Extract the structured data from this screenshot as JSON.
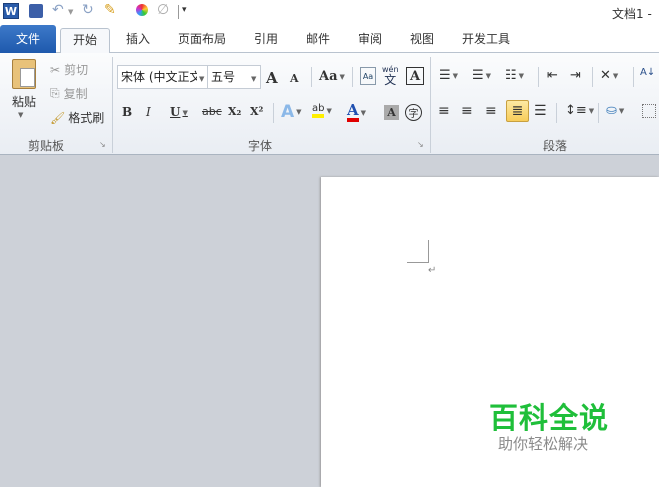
{
  "window": {
    "title": "文档1 -"
  },
  "qat": {
    "app_icon": "W"
  },
  "tabs": [
    {
      "label": "文件"
    },
    {
      "label": "开始"
    },
    {
      "label": "插入"
    },
    {
      "label": "页面布局"
    },
    {
      "label": "引用"
    },
    {
      "label": "邮件"
    },
    {
      "label": "审阅"
    },
    {
      "label": "视图"
    },
    {
      "label": "开发工具"
    }
  ],
  "clipboard": {
    "paste": "粘贴",
    "cut": "剪切",
    "copy": "复制",
    "format_painter": "格式刷",
    "group": "剪贴板"
  },
  "font": {
    "name": "宋体 (中文正文",
    "size": "五号",
    "group": "字体",
    "change_case": "Aa",
    "bold": "B",
    "italic": "I",
    "underline": "U",
    "strike": "abc",
    "sub": "X₂",
    "sup": "X²",
    "pinyin": "wén",
    "pinyin_char": "文",
    "border_char": "A",
    "effects": "A",
    "font_color": "A",
    "shading": "A",
    "enclose": "字",
    "grow": "A",
    "shrink": "A",
    "highlight": "ab"
  },
  "paragraph": {
    "group": "段落"
  },
  "colors": {
    "accent": "#1e59ad",
    "watermark_green": "#1fbf3a"
  },
  "watermark": {
    "title": "百科全说",
    "subtitle": "助你轻松解决"
  },
  "document": {
    "paragraph_mark": "↵"
  }
}
